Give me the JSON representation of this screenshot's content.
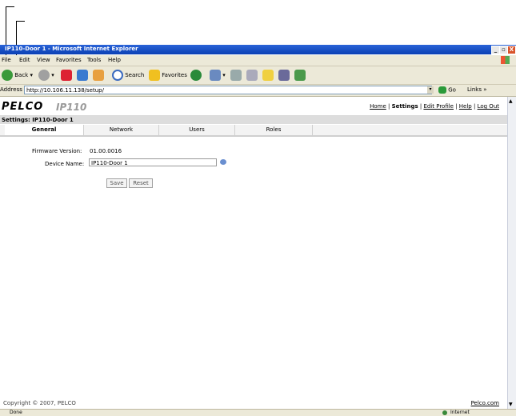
{
  "window": {
    "title": "IP110-Door 1 - Microsoft Internet Explorer",
    "controls": [
      "_",
      "▫",
      "X"
    ]
  },
  "menu": {
    "items": [
      "File",
      "Edit",
      "View",
      "Favorites",
      "Tools",
      "Help"
    ]
  },
  "toolbar": {
    "back_label": "Back",
    "search_label": "Search",
    "favorites_label": "Favorites"
  },
  "address": {
    "label": "Address",
    "url": "http://10.106.11.138/setup/",
    "go_label": "Go",
    "links_label": "Links"
  },
  "header": {
    "logo": "PELCO",
    "model": "IP110",
    "nav": {
      "home": "Home",
      "settings": "Settings",
      "edit_profile": "Edit Profile",
      "help": "Help",
      "logout": "Log Out"
    }
  },
  "settings_title": "Settings: IP110-Door 1",
  "tabs": [
    "General",
    "Network",
    "Users",
    "Roles"
  ],
  "form": {
    "firmware_label": "Firmware Version:",
    "firmware_value": "01.00.0016",
    "device_name_label": "Device Name:",
    "device_name_value": "IP110-Door 1",
    "save_label": "Save",
    "reset_label": "Reset"
  },
  "footer": {
    "copyright": "Copyright © 2007, PELCO",
    "link": "Pelco.com"
  },
  "status": {
    "text": "Done",
    "zone": "Internet"
  }
}
